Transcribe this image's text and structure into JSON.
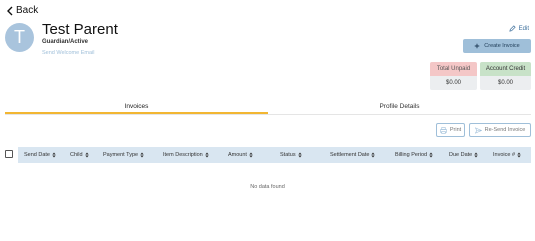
{
  "nav": {
    "back_label": "Back"
  },
  "profile": {
    "initial": "T",
    "name": "Test Parent",
    "role": "Guardian/Active",
    "welcome_link": "Send Welcome Email",
    "edit_label": "Edit"
  },
  "actions": {
    "create_invoice": "Create Invoice"
  },
  "summary": {
    "total_unpaid": {
      "label": "Total Unpaid",
      "value": "$0.00"
    },
    "account_credit": {
      "label": "Account Credit",
      "value": "$0.00"
    }
  },
  "tabs": [
    {
      "label": "Invoices",
      "active": true
    },
    {
      "label": "Profile Details",
      "active": false
    }
  ],
  "toolbar": {
    "print": "Print",
    "resend": "Re-Send Invoice"
  },
  "table": {
    "columns": [
      "Send Date",
      "Child",
      "Payment Type",
      "Item Description",
      "Amount",
      "Status",
      "Settlement Date",
      "Billing Period",
      "Due Date",
      "Invoice #"
    ],
    "empty_text": "No data found"
  },
  "colors": {
    "accent": "#9fbfd9",
    "tab_underline": "#f2b632",
    "unpaid_bg": "#f4c7c7",
    "credit_bg": "#c8e2c8",
    "header_bg": "#d9e6f1"
  }
}
